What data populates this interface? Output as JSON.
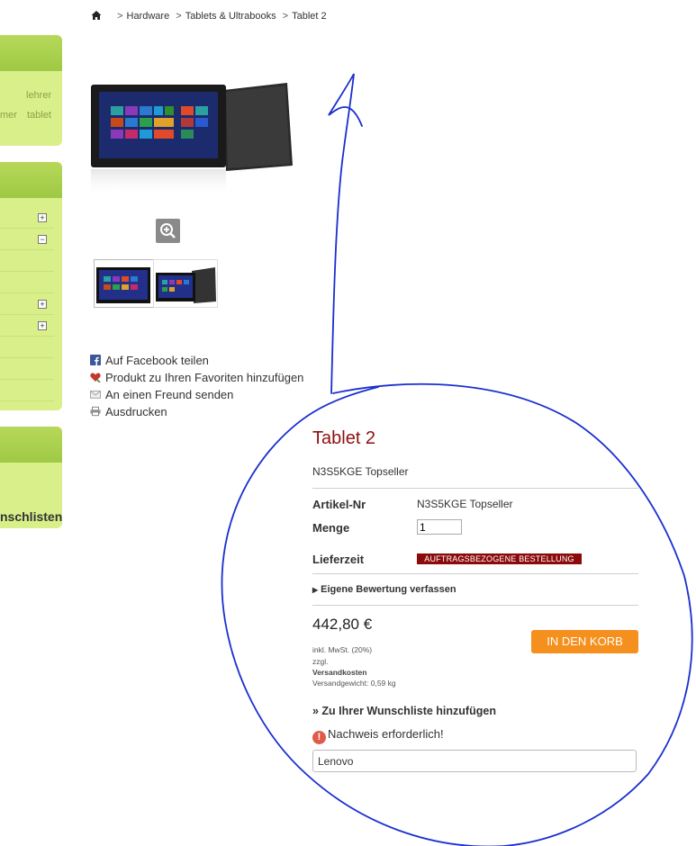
{
  "sidebar": {
    "tag_words": [
      "lehrer",
      "mer",
      "tablet"
    ],
    "wishlist_link": "nschlisten"
  },
  "breadcrumb": {
    "items": [
      "Hardware",
      "Tablets & Ultrabooks",
      "Tablet 2"
    ],
    "separator": ">"
  },
  "share": {
    "facebook": "Auf Facebook teilen",
    "favorites": "Produkt zu Ihren Favoriten hinzufügen",
    "friend": "An einen Freund senden",
    "print": "Ausdrucken"
  },
  "product": {
    "title": "Tablet 2",
    "subtitle": "N3S5KGE Topseller",
    "sku_label": "Artikel-Nr",
    "sku_value": "N3S5KGE Topseller",
    "qty_label": "Menge",
    "qty_value": "1",
    "delivery_label": "Lieferzeit",
    "delivery_badge": "AUFTRAGSBEZOGENE BESTELLUNG",
    "review_link": "Eigene Bewertung verfassen",
    "price": "442,80 €",
    "cart_button": "IN DEN KORB",
    "tax_note": "inkl. MwSt. (20%)",
    "shipping_prefix": "zzgl.",
    "shipping_link": "Versandkosten",
    "weight_note": "Versandgewicht: 0,59 kg",
    "wishlist_link": "» Zu Ihrer Wunschliste hinzufügen",
    "warning": "Nachweis erforderlich!",
    "brand_value": "Lenovo"
  },
  "colors": {
    "sidebar_bg": "#d9ef8a",
    "title": "#8b1010",
    "badge": "#8b0b0b",
    "cart": "#f5901e",
    "scribble": "#1a2fcf"
  }
}
